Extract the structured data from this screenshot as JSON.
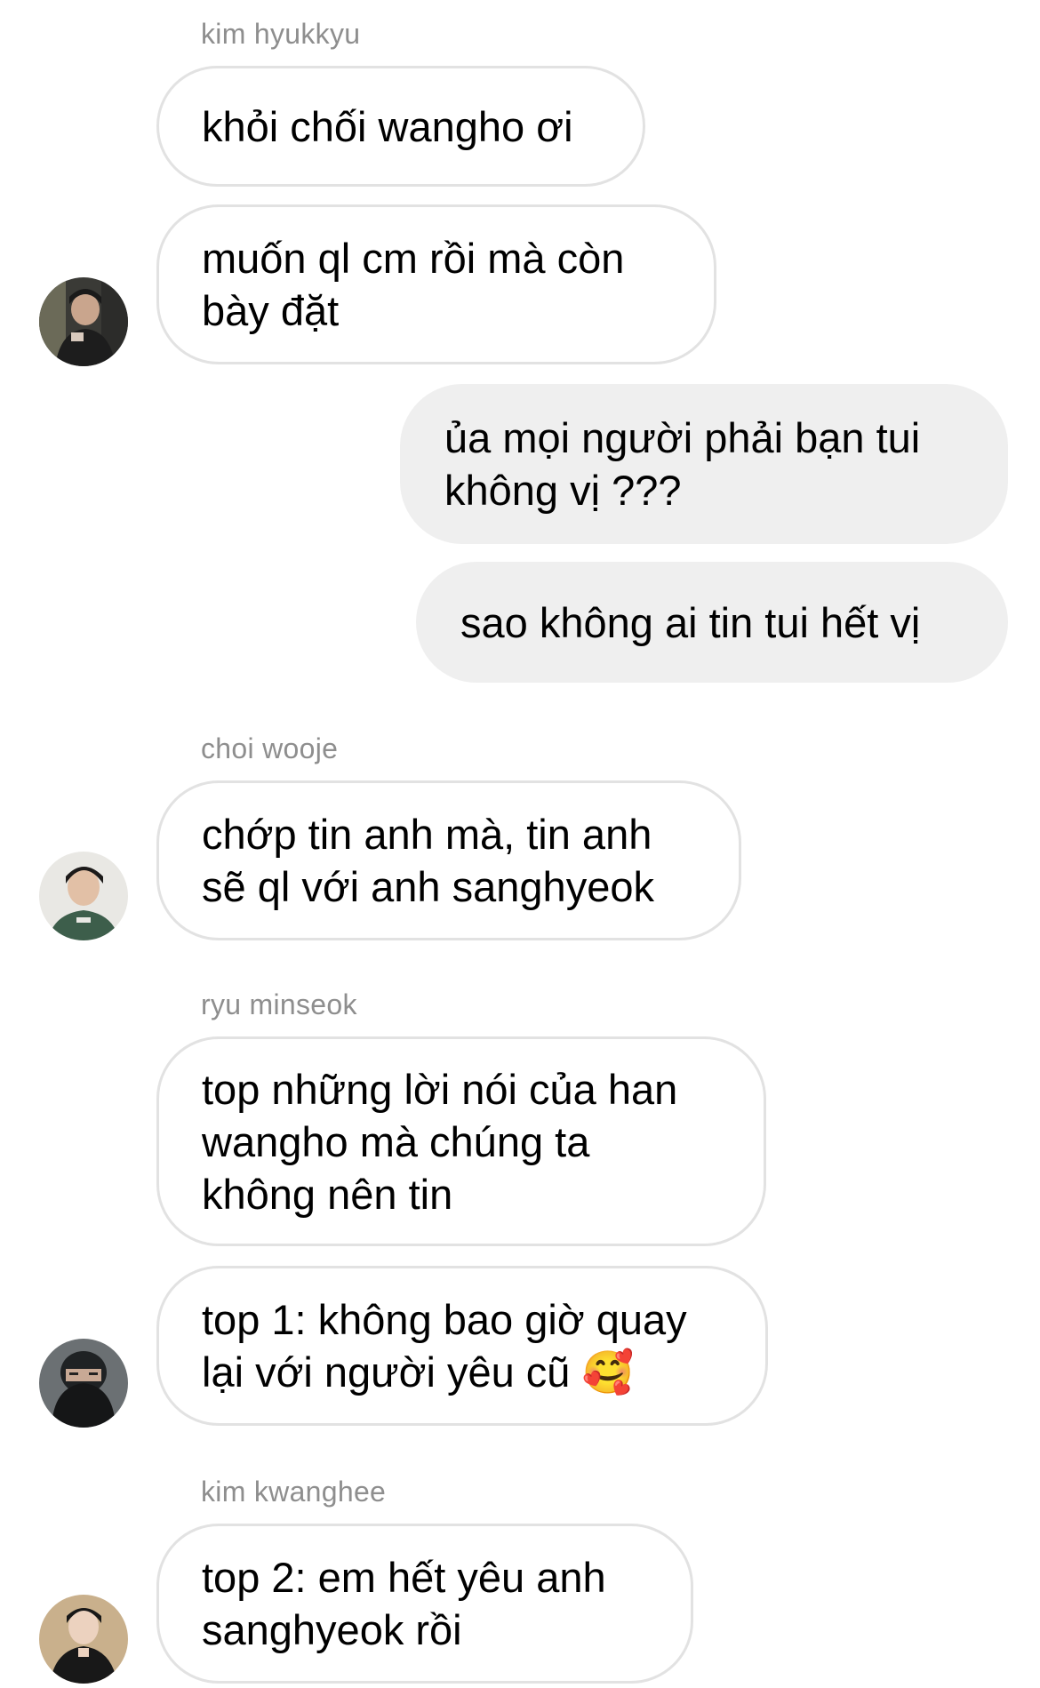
{
  "conversation": {
    "groups": [
      {
        "sender": "kim hyukkyu",
        "messages": [
          "khỏi chối wangho ơi",
          "muốn ql cm rồi mà còn\nbày đặt"
        ]
      },
      {
        "sender": "",
        "outgoing": true,
        "messages": [
          "ủa mọi người phải bạn tui\nkhông vị ???",
          "sao không ai tin tui hết vị"
        ]
      },
      {
        "sender": "choi wooje",
        "messages": [
          "chớp tin anh mà, tin anh\nsẽ ql với anh sanghyeok"
        ]
      },
      {
        "sender": "ryu minseok",
        "messages": [
          "top những lời nói của han\nwangho mà chúng ta\nkhông nên tin",
          "top 1: không bao giờ quay\nlại với người yêu cũ 🥰"
        ]
      },
      {
        "sender": "kim kwanghee",
        "messages": [
          "top 2: em hết yêu anh\nsanghyeok rồi"
        ]
      }
    ]
  },
  "colors": {
    "incoming_border": "#e2e2e2",
    "outgoing_bg": "#efefef",
    "sender_name": "#8e8e8e"
  }
}
